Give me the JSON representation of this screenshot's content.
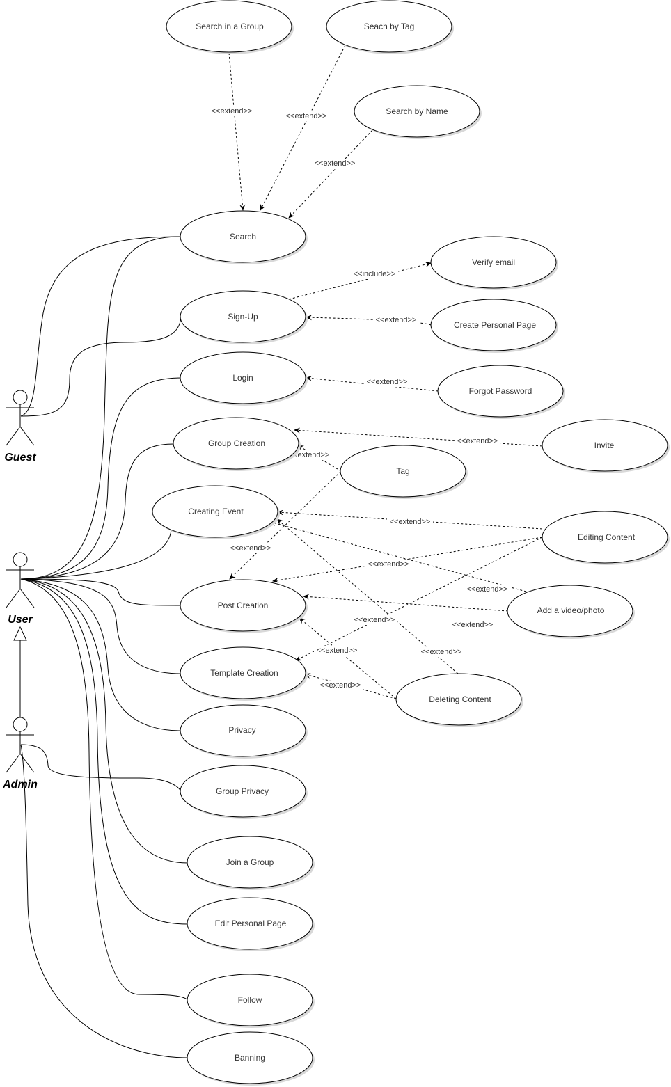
{
  "diagram": {
    "type": "UML use case diagram",
    "actors": [
      {
        "id": "guest",
        "label": "Guest"
      },
      {
        "id": "user",
        "label": "User"
      },
      {
        "id": "admin",
        "label": "Admin"
      }
    ],
    "generalizations": [
      {
        "from": "admin",
        "to": "user"
      }
    ],
    "use_cases": [
      {
        "id": "search_in_group",
        "label": "Search in a Group"
      },
      {
        "id": "search_by_tag",
        "label": "Seach by Tag"
      },
      {
        "id": "search_by_name",
        "label": "Search by Name"
      },
      {
        "id": "search",
        "label": "Search"
      },
      {
        "id": "verify_email",
        "label": "Verify email"
      },
      {
        "id": "sign_up",
        "label": "Sign-Up"
      },
      {
        "id": "create_personal_page",
        "label": "Create Personal Page"
      },
      {
        "id": "login",
        "label": "Login"
      },
      {
        "id": "forgot_password",
        "label": "Forgot Password"
      },
      {
        "id": "group_creation",
        "label": "Group Creation"
      },
      {
        "id": "invite",
        "label": "Invite"
      },
      {
        "id": "tag",
        "label": "Tag"
      },
      {
        "id": "creating_event",
        "label": "Creating Event"
      },
      {
        "id": "editing_content",
        "label": "Editing Content"
      },
      {
        "id": "post_creation",
        "label": "Post Creation"
      },
      {
        "id": "add_video_photo",
        "label": "Add a video/photo"
      },
      {
        "id": "template_creation",
        "label": "Template Creation"
      },
      {
        "id": "deleting_content",
        "label": "Deleting Content"
      },
      {
        "id": "privacy",
        "label": "Privacy"
      },
      {
        "id": "group_privacy",
        "label": "Group Privacy"
      },
      {
        "id": "join_group",
        "label": "Join a Group"
      },
      {
        "id": "edit_personal_page",
        "label": "Edit Personal Page"
      },
      {
        "id": "follow",
        "label": "Follow"
      },
      {
        "id": "banning",
        "label": "Banning"
      }
    ],
    "associations": [
      {
        "actor": "guest",
        "use_case": "search"
      },
      {
        "actor": "guest",
        "use_case": "sign_up"
      },
      {
        "actor": "user",
        "use_case": "search"
      },
      {
        "actor": "user",
        "use_case": "login"
      },
      {
        "actor": "user",
        "use_case": "group_creation"
      },
      {
        "actor": "user",
        "use_case": "creating_event"
      },
      {
        "actor": "user",
        "use_case": "post_creation"
      },
      {
        "actor": "user",
        "use_case": "template_creation"
      },
      {
        "actor": "user",
        "use_case": "privacy"
      },
      {
        "actor": "user",
        "use_case": "join_group"
      },
      {
        "actor": "user",
        "use_case": "edit_personal_page"
      },
      {
        "actor": "user",
        "use_case": "follow"
      },
      {
        "actor": "admin",
        "use_case": "group_privacy"
      },
      {
        "actor": "admin",
        "use_case": "banning"
      }
    ],
    "dependencies": [
      {
        "from": "search_in_group",
        "to": "search",
        "label": "<<extend>>"
      },
      {
        "from": "search_by_tag",
        "to": "search",
        "label": "<<extend>>"
      },
      {
        "from": "search_by_name",
        "to": "search",
        "label": "<<extend>>"
      },
      {
        "from": "sign_up",
        "to": "verify_email",
        "label": "<<include>>"
      },
      {
        "from": "create_personal_page",
        "to": "sign_up",
        "label": "<<extend>>"
      },
      {
        "from": "forgot_password",
        "to": "login",
        "label": "<<extend>>"
      },
      {
        "from": "invite",
        "to": "group_creation",
        "label": "<<extend>>"
      },
      {
        "from": "tag",
        "to": "group_creation",
        "label": "<<extend>>"
      },
      {
        "from": "tag",
        "to": "post_creation",
        "label": "<<extend>>"
      },
      {
        "from": "editing_content",
        "to": "creating_event",
        "label": "<<extend>>"
      },
      {
        "from": "editing_content",
        "to": "post_creation",
        "label": "<<extend>>"
      },
      {
        "from": "editing_content",
        "to": "template_creation",
        "label": "<<extend>>"
      },
      {
        "from": "add_video_photo",
        "to": "creating_event",
        "label": "<<extend>>"
      },
      {
        "from": "add_video_photo",
        "to": "post_creation",
        "label": "<<extend>>"
      },
      {
        "from": "deleting_content",
        "to": "creating_event",
        "label": "<<extend>>"
      },
      {
        "from": "deleting_content",
        "to": "post_creation",
        "label": "<<extend>>"
      },
      {
        "from": "deleting_content",
        "to": "template_creation",
        "label": "<<extend>>"
      }
    ],
    "stray_labels": [
      {
        "id": "stray_extend",
        "label": "<<extend>>"
      }
    ]
  }
}
